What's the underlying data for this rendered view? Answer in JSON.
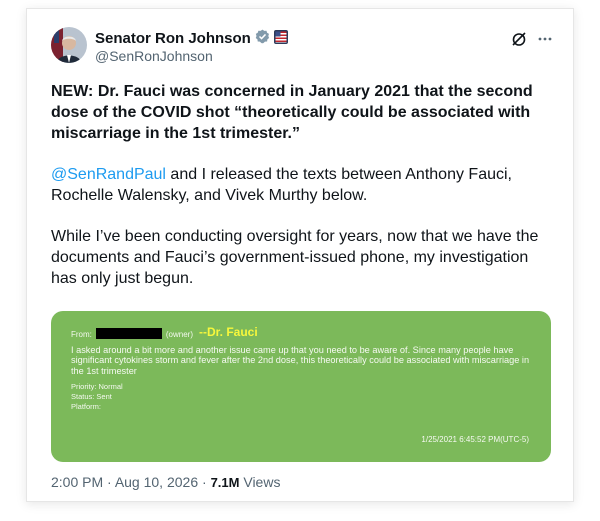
{
  "author": {
    "name": "Senator Ron Johnson",
    "handle": "@SenRonJohnson",
    "verified_color": "#829aab",
    "flag_icon": "us-flag-icon"
  },
  "tweet": {
    "headline": "NEW: Dr. Fauci was concerned in January 2021 that the second dose of the COVID shot “theoretically could be associated with miscarriage in the 1st trimester.”",
    "para2_mention": "@SenRandPaul",
    "para2_rest": " and I released the texts between Anthony Fauci, Rochelle Walensky, and Vivek Murthy below.",
    "para3": "While I’ve been conducting oversight for years, now that we have the documents and Fauci’s government-issued phone, my investigation has only just begun."
  },
  "card": {
    "from_label": "From:",
    "owner_label": "(owner)",
    "sender": "--Dr. Fauci",
    "message": "I asked around a bit more and another issue came up that you need to be aware of.  Since many people have significant cytokines storm and fever after the 2nd dose, this theoretically could be associated with miscarriage in the 1st trimester",
    "priority": "Priority: Normal",
    "status": "Status: Sent",
    "platform": "Platform:",
    "timestamp": "1/25/2021 6:45:52 PM(UTC-5)",
    "bg_color": "#7cb95a",
    "sender_color": "#f7f73c"
  },
  "footer": {
    "time": "2:00 PM",
    "sep1": " · ",
    "date": "Aug 10, 2026",
    "sep2": " · ",
    "views_count": "7.1M",
    "views_label": " Views"
  },
  "actions": {
    "grok_icon": "grok-icon",
    "more_icon": "more-icon"
  }
}
